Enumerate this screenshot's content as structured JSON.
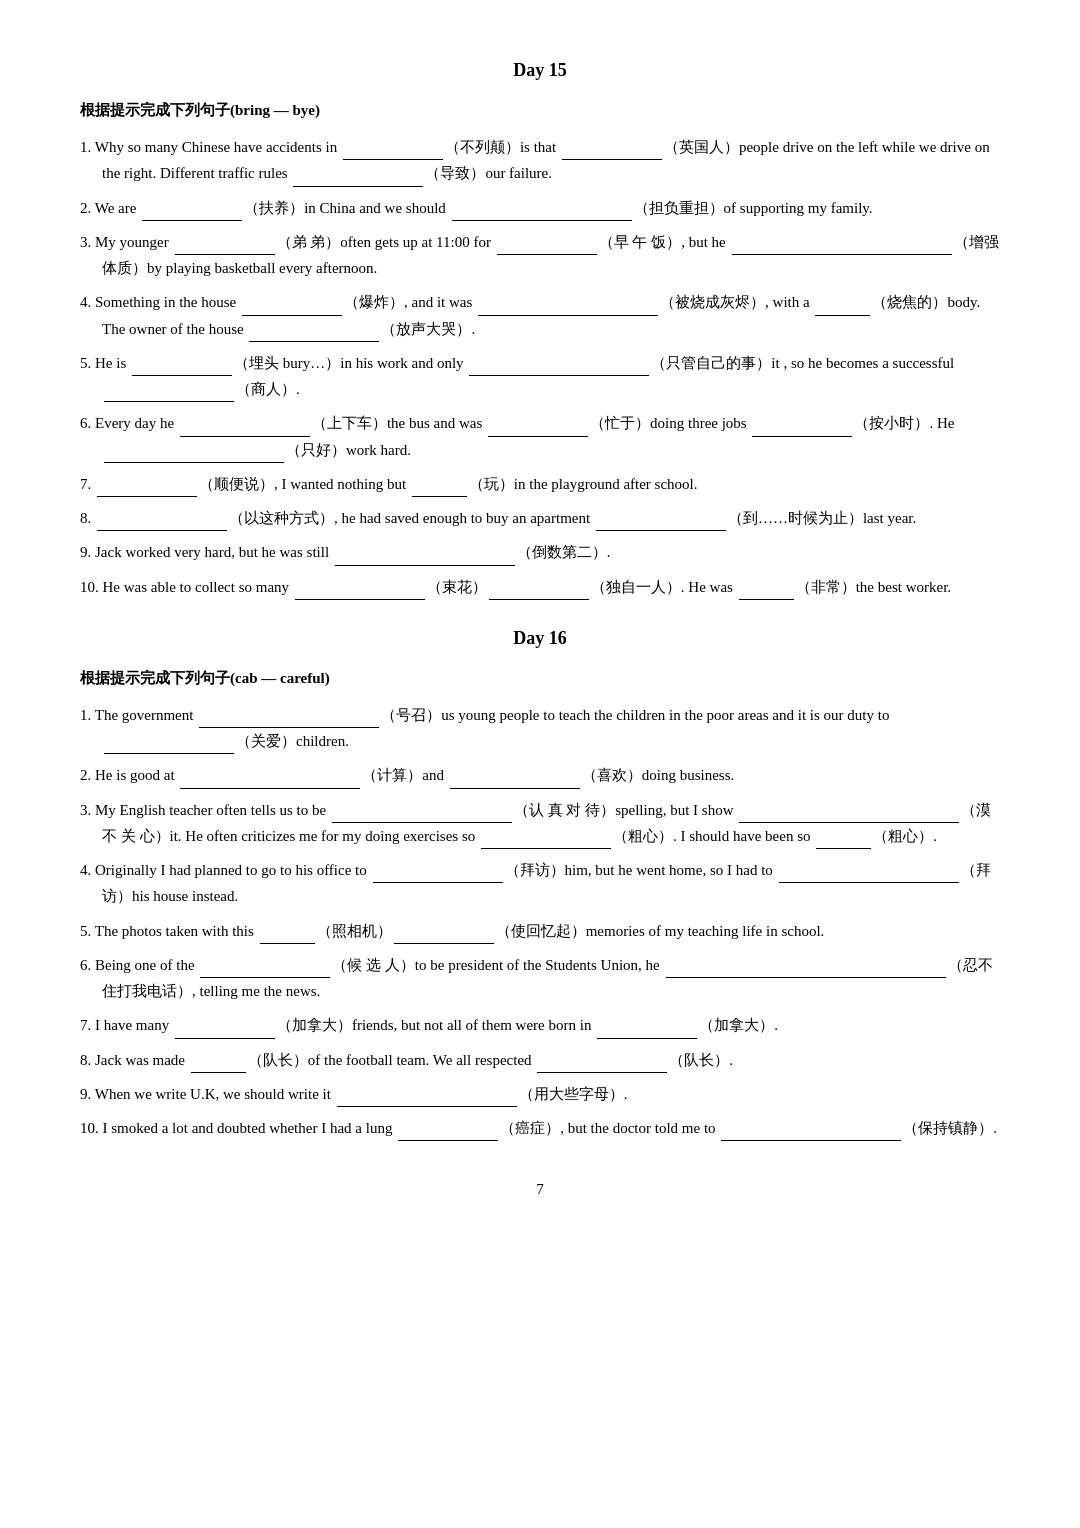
{
  "page": {
    "number": "7"
  },
  "day15": {
    "title": "Day 15",
    "section_header": "根据提示完成下列句子(bring — bye)",
    "items": [
      {
        "num": "1.",
        "text_parts": [
          "Why so many Chinese have accidents in",
          "(不列颠) is that",
          "(英国人) people drive on the left while we drive on the right. Different traffic rules",
          "(导致) our failure."
        ],
        "blanks": [
          "sm",
          "sm",
          "md"
        ]
      },
      {
        "num": "2.",
        "text": "We are __________(扶养) in China and we should __________________(担负重担) of supporting my family."
      },
      {
        "num": "3.",
        "text": "My younger _______（弟 弟）often gets up at 11:00 for ________（早 午 饭）, but he ____________________(增强体质) by playing basketball every afternoon."
      },
      {
        "num": "4.",
        "text": "Something in the house _________（爆炸）, and it was _______________________（被烧成灰烬）, with a _________(烧焦的) body. The owner of the house _____________(放声大哭)."
      },
      {
        "num": "5.",
        "text": "He is _______(埋头 bury…) in his work and only _____________________(只管自己的事) it , so he becomes a successful _____________(商人)."
      },
      {
        "num": "6.",
        "text": "Every day he ________________（上下车）the bus and was __________（忙于）doing three jobs _____________(按小时). He ____________________(只好) work hard."
      },
      {
        "num": "7.",
        "text": "___________(顺便说), I wanted nothing but _________(玩) in the playground after school."
      },
      {
        "num": "8.",
        "text": "_____________(以这种方式), he had saved enough to buy an apartment _____________(到……时候为止) last year."
      },
      {
        "num": "9.",
        "text": "Jack worked very hard, but he was still _________________(倒数第二)."
      },
      {
        "num": "10.",
        "text": "He was able to collect so many _________________(束花) ___________(独自一人). He was _______(非常) the best worker."
      }
    ]
  },
  "day16": {
    "title": "Day 16",
    "section_header": "根据提示完成下列句子(cab — careful)",
    "items": [
      {
        "num": "1.",
        "text": "The government _________________(号召) us young people to teach the children in the poor areas and it is our duty to _____________(关爱) children."
      },
      {
        "num": "2.",
        "text": "He is good at _________________(计算) and _______________(喜欢) doing business."
      },
      {
        "num": "3.",
        "text": "My English teacher often tells us to be ________________（认 真 对 待）spelling, but I show ____________________(漠 不 关 心) it. He often criticizes me for my doing exercises so _______________(粗心). I should have been so _________(粗心)."
      },
      {
        "num": "4.",
        "text": "Originally I had planned to go to his office to ________________(拜访) him, but he went home, so I had to __________________(拜访) his house instead."
      },
      {
        "num": "5.",
        "text": "The photos taken with this _______(照相机) _________(使回忆起) memories of my teaching life in school."
      },
      {
        "num": "6.",
        "text": "Being one of the ____________（候 选 人）to be president of the Students Union, he ___________________________________(忍不住打我电话), telling me the news."
      },
      {
        "num": "7.",
        "text": "I have many ___________(加拿大) friends, but not all of them were born in __________(加拿大)."
      },
      {
        "num": "8.",
        "text": "Jack was made _______(队长) of the football team. We all respected _____________(队长)."
      },
      {
        "num": "9.",
        "text": "When we write U.K, we should write it _________________(用大些字母)."
      },
      {
        "num": "10.",
        "text": "I smoked a lot and doubted whether I had a lung _________（癌症）, but the doctor told me to ____________________(保持镇静)."
      }
    ]
  }
}
